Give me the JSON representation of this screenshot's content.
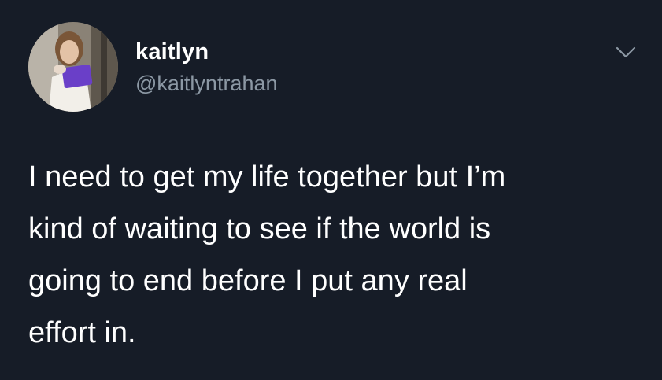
{
  "tweet": {
    "author": {
      "display_name": "kaitlyn",
      "handle": "@kaitlyntrahan",
      "avatar_icon": "profile-photo"
    },
    "menu_icon": "chevron-down-icon",
    "text_lines": [
      "I need to get my life together but I’m",
      "kind of waiting to see if the world is",
      "going to end before I put any real",
      "effort in."
    ]
  },
  "colors": {
    "background": "#161c27",
    "primary_text": "#ffffff",
    "secondary_text": "#8c98a4"
  }
}
